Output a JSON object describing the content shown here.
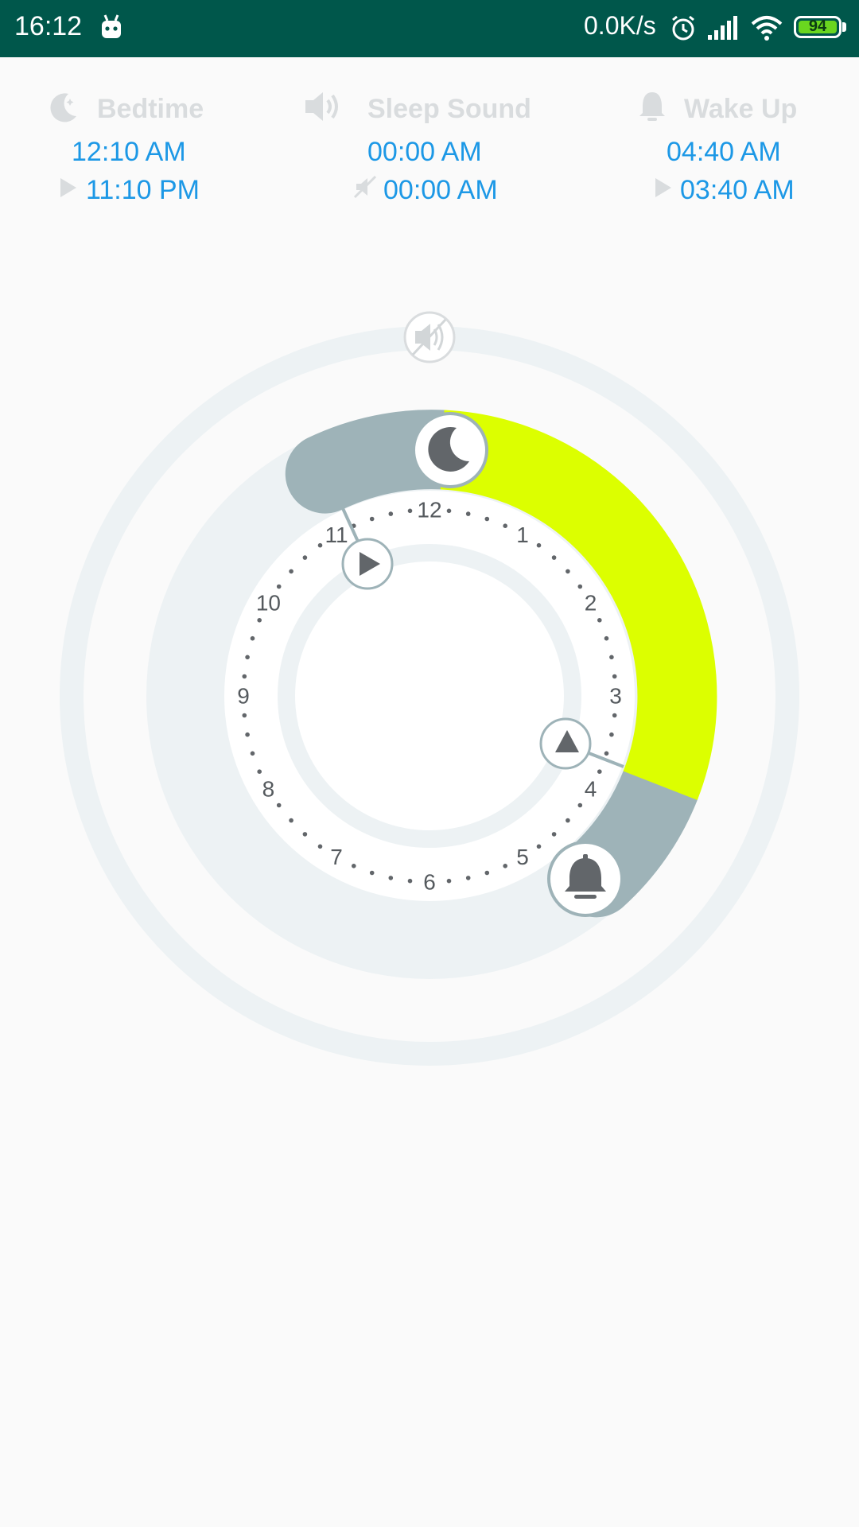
{
  "status_bar": {
    "time": "16:12",
    "net_speed": "0.0K/s",
    "battery": "94",
    "icons": [
      "android-icon",
      "alarm-icon",
      "signal-icon",
      "wifi-icon",
      "battery-icon"
    ]
  },
  "bedtime": {
    "label": "Bedtime",
    "time": "12:10 AM",
    "start_time": "11:10 PM",
    "icon": "moon-icon"
  },
  "sleep_sound": {
    "label": "Sleep Sound",
    "time": "00:00 AM",
    "stop_time": "00:00 AM",
    "icon": "speaker-icon"
  },
  "wake_up": {
    "label": "Wake Up",
    "time": "04:40 AM",
    "start_time": "03:40 AM",
    "icon": "bell-icon"
  },
  "dial": {
    "hours": [
      "12",
      "1",
      "2",
      "3",
      "4",
      "5",
      "6",
      "7",
      "8",
      "9",
      "10",
      "11"
    ],
    "sleep_arc_color": "#dcff00",
    "window_color": "#9eb3b8",
    "track_color": "#edf2f4"
  }
}
